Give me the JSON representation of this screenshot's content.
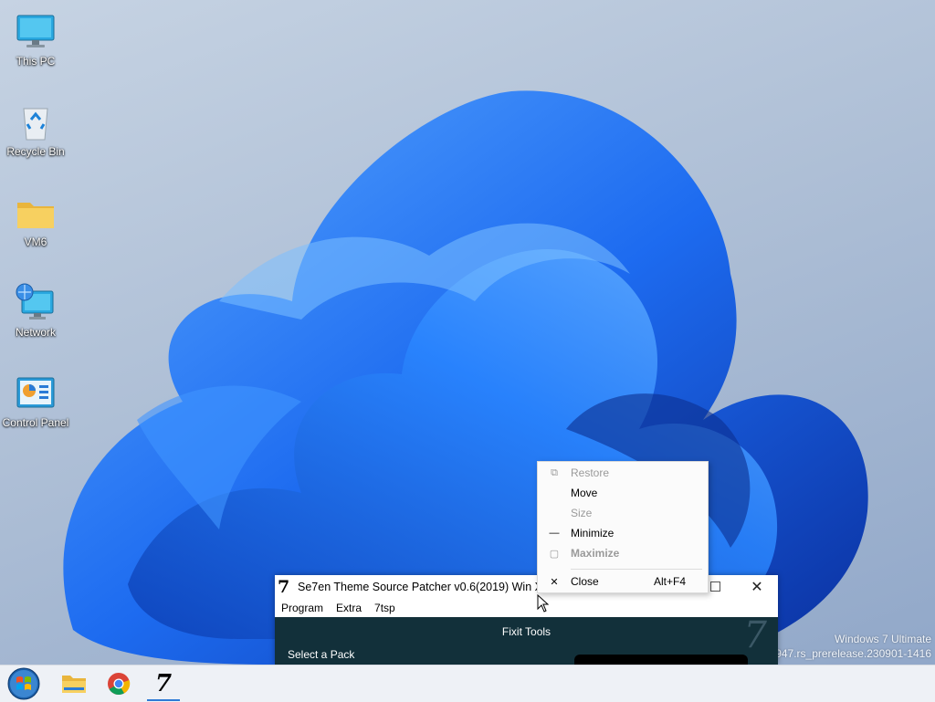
{
  "desktop": {
    "icons": [
      {
        "label": "This PC",
        "icon": "monitor-icon"
      },
      {
        "label": "Recycle Bin",
        "icon": "recycle-bin-icon"
      },
      {
        "label": "VM6",
        "icon": "folder-icon"
      },
      {
        "label": "Network",
        "icon": "network-icon"
      },
      {
        "label": "Control Panel",
        "icon": "control-panel-icon"
      }
    ],
    "watermark": {
      "line1": "Windows 7 Ultimate",
      "line2": "25947.rs_prerelease.230901-1416"
    }
  },
  "app_window": {
    "logo": "7",
    "title": "Se7en Theme Source Patcher v0.6(2019) Win X64",
    "menu": [
      "Program",
      "Extra",
      "7tsp"
    ],
    "maximize_icon": "maximize-icon",
    "close_icon": "close-icon",
    "body": {
      "heading": "Fixit Tools",
      "select_label": "Select a Pack",
      "logo_mark": "7"
    }
  },
  "context_menu": {
    "items": [
      {
        "label": "Restore",
        "icon": "restore-icon",
        "enabled": false
      },
      {
        "label": "Move",
        "icon": "",
        "enabled": true
      },
      {
        "label": "Size",
        "icon": "",
        "enabled": false
      },
      {
        "label": "Minimize",
        "icon": "minimize-icon",
        "enabled": true
      },
      {
        "label": "Maximize",
        "icon": "maximize-icon",
        "enabled": false
      },
      {
        "label": "Close",
        "icon": "close-icon",
        "enabled": true,
        "accelerator": "Alt+F4"
      }
    ]
  },
  "taskbar": {
    "items": [
      {
        "name": "start-button",
        "icon": "windows-orb-icon"
      },
      {
        "name": "file-explorer",
        "icon": "file-explorer-icon"
      },
      {
        "name": "chrome",
        "icon": "chrome-icon"
      },
      {
        "name": "7tsp",
        "icon": "7tsp-icon",
        "active": true,
        "label": "7"
      }
    ]
  },
  "colors": {
    "accent": "#2e7bd6",
    "app_body": "#12303a",
    "wallpaper_bloom": "#1a5fe0"
  }
}
